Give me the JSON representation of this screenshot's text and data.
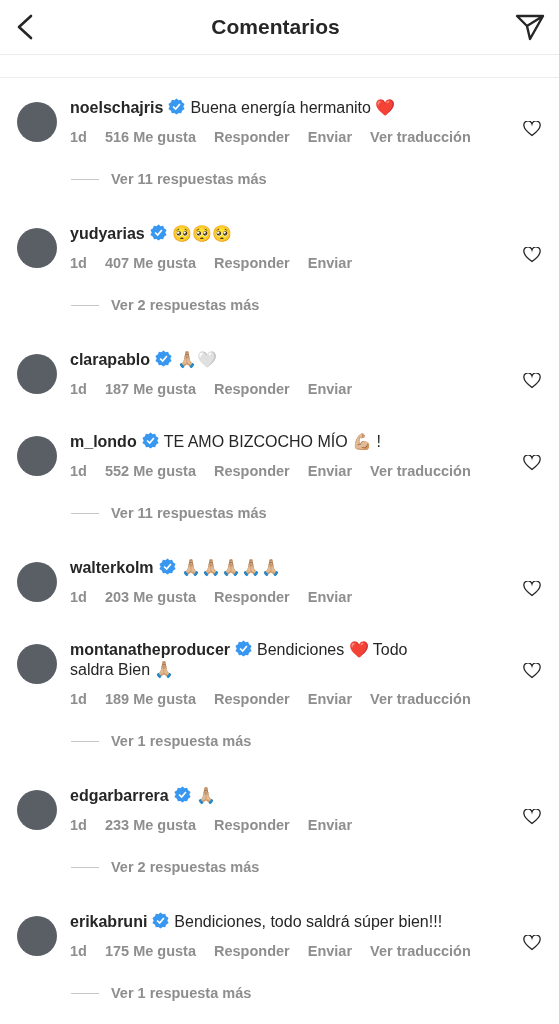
{
  "header": {
    "title": "Comentarios"
  },
  "comments": [
    {
      "username": "noelschajris",
      "verified": true,
      "text": "Buena energía hermanito ❤️",
      "time": "1d",
      "likes": "516 Me gusta",
      "actions": [
        "Responder",
        "Enviar",
        "Ver traducción"
      ],
      "replies": "Ver 11 respuestas más"
    },
    {
      "username": "yudyarias",
      "verified": true,
      "text": "🥺🥺🥺",
      "time": "1d",
      "likes": "407 Me gusta",
      "actions": [
        "Responder",
        "Enviar"
      ],
      "replies": "Ver 2 respuestas más"
    },
    {
      "username": "clarapablo",
      "verified": true,
      "text": "🙏🏼🤍",
      "time": "1d",
      "likes": "187 Me gusta",
      "actions": [
        "Responder",
        "Enviar"
      ]
    },
    {
      "username": "m_londo",
      "verified": true,
      "text": "TE AMO BIZCOCHO MÍO 💪🏼 !",
      "time": "1d",
      "likes": "552 Me gusta",
      "actions": [
        "Responder",
        "Enviar",
        "Ver traducción"
      ],
      "replies": "Ver 11 respuestas más"
    },
    {
      "username": "walterkolm",
      "verified": true,
      "text": "🙏🏼🙏🏼🙏🏼🙏🏼🙏🏼",
      "time": "1d",
      "likes": "203 Me gusta",
      "actions": [
        "Responder",
        "Enviar"
      ]
    },
    {
      "username": "montanatheproducer",
      "verified": true,
      "text": "Bendiciones ❤️ Todo saldra Bien 🙏🏼",
      "time": "1d",
      "likes": "189 Me gusta",
      "actions": [
        "Responder",
        "Enviar",
        "Ver traducción"
      ],
      "replies": "Ver 1 respuesta más"
    },
    {
      "username": "edgarbarrera",
      "verified": true,
      "text": "🙏🏼",
      "time": "1d",
      "likes": "233 Me gusta",
      "actions": [
        "Responder",
        "Enviar"
      ],
      "replies": "Ver 2 respuestas más"
    },
    {
      "username": "erikabruni",
      "verified": true,
      "text": "Bendiciones, todo saldrá súper bien!!!",
      "time": "1d",
      "likes": "175 Me gusta",
      "actions": [
        "Responder",
        "Enviar",
        "Ver traducción"
      ],
      "replies": "Ver 1 respuesta más"
    }
  ]
}
